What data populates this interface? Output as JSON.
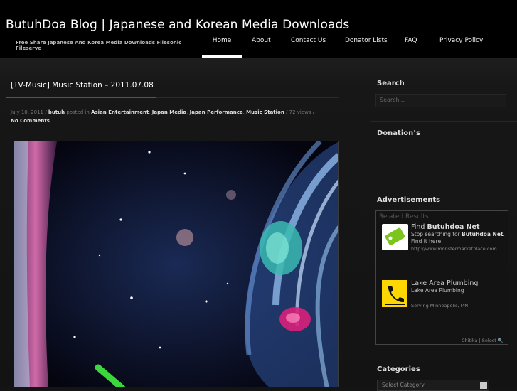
{
  "header": {
    "site_title": "ButuhDoa Blog | Japanese and Korean Media Downloads",
    "tagline": "Free Share Japanese And Korea Media Downloads Filesonic Fileserve"
  },
  "nav": {
    "items": [
      {
        "label": "Home",
        "active": true
      },
      {
        "label": "About"
      },
      {
        "label": "Contact Us"
      },
      {
        "label": "Donator Lists"
      },
      {
        "label": "FAQ"
      },
      {
        "label": "Privacy Policy"
      }
    ]
  },
  "post": {
    "title": "[TV-Music] Music Station – 2011.07.08",
    "date": "July 10, 2011",
    "author": "butuh",
    "posted_in": "posted in",
    "categories": [
      "Asian Entertainment",
      "Japan Media",
      "Japan Performance",
      "Music Station"
    ],
    "views": "72 views",
    "comments": "No Comments"
  },
  "sidebar": {
    "search_title": "Search",
    "search_placeholder": "Search...",
    "donation_title": "Donation’s",
    "ads_title": "Advertisements",
    "categories_title": "Categories",
    "categories_select": "Select Category"
  },
  "ads": {
    "related": "Related Results",
    "ad1_title_pre": "Find ",
    "ad1_title_bold": "Butuhdoa Net",
    "ad1_text_pre": "Stop searching for ",
    "ad1_text_bold": "Butuhdoa Net",
    "ad1_text_post": ". Find it here!",
    "ad1_url": "http://www.monstermarketplace.com",
    "ad2_title": "Lake Area Plumbing",
    "ad2_text": "Lake Area Plumbing",
    "ad2_sub": "Serving Minneapolis, MN",
    "footer": "Chitika | Select"
  },
  "colors": {
    "header_bg": "#000000",
    "page_bg": "#141414",
    "accent": "#ffffff"
  }
}
